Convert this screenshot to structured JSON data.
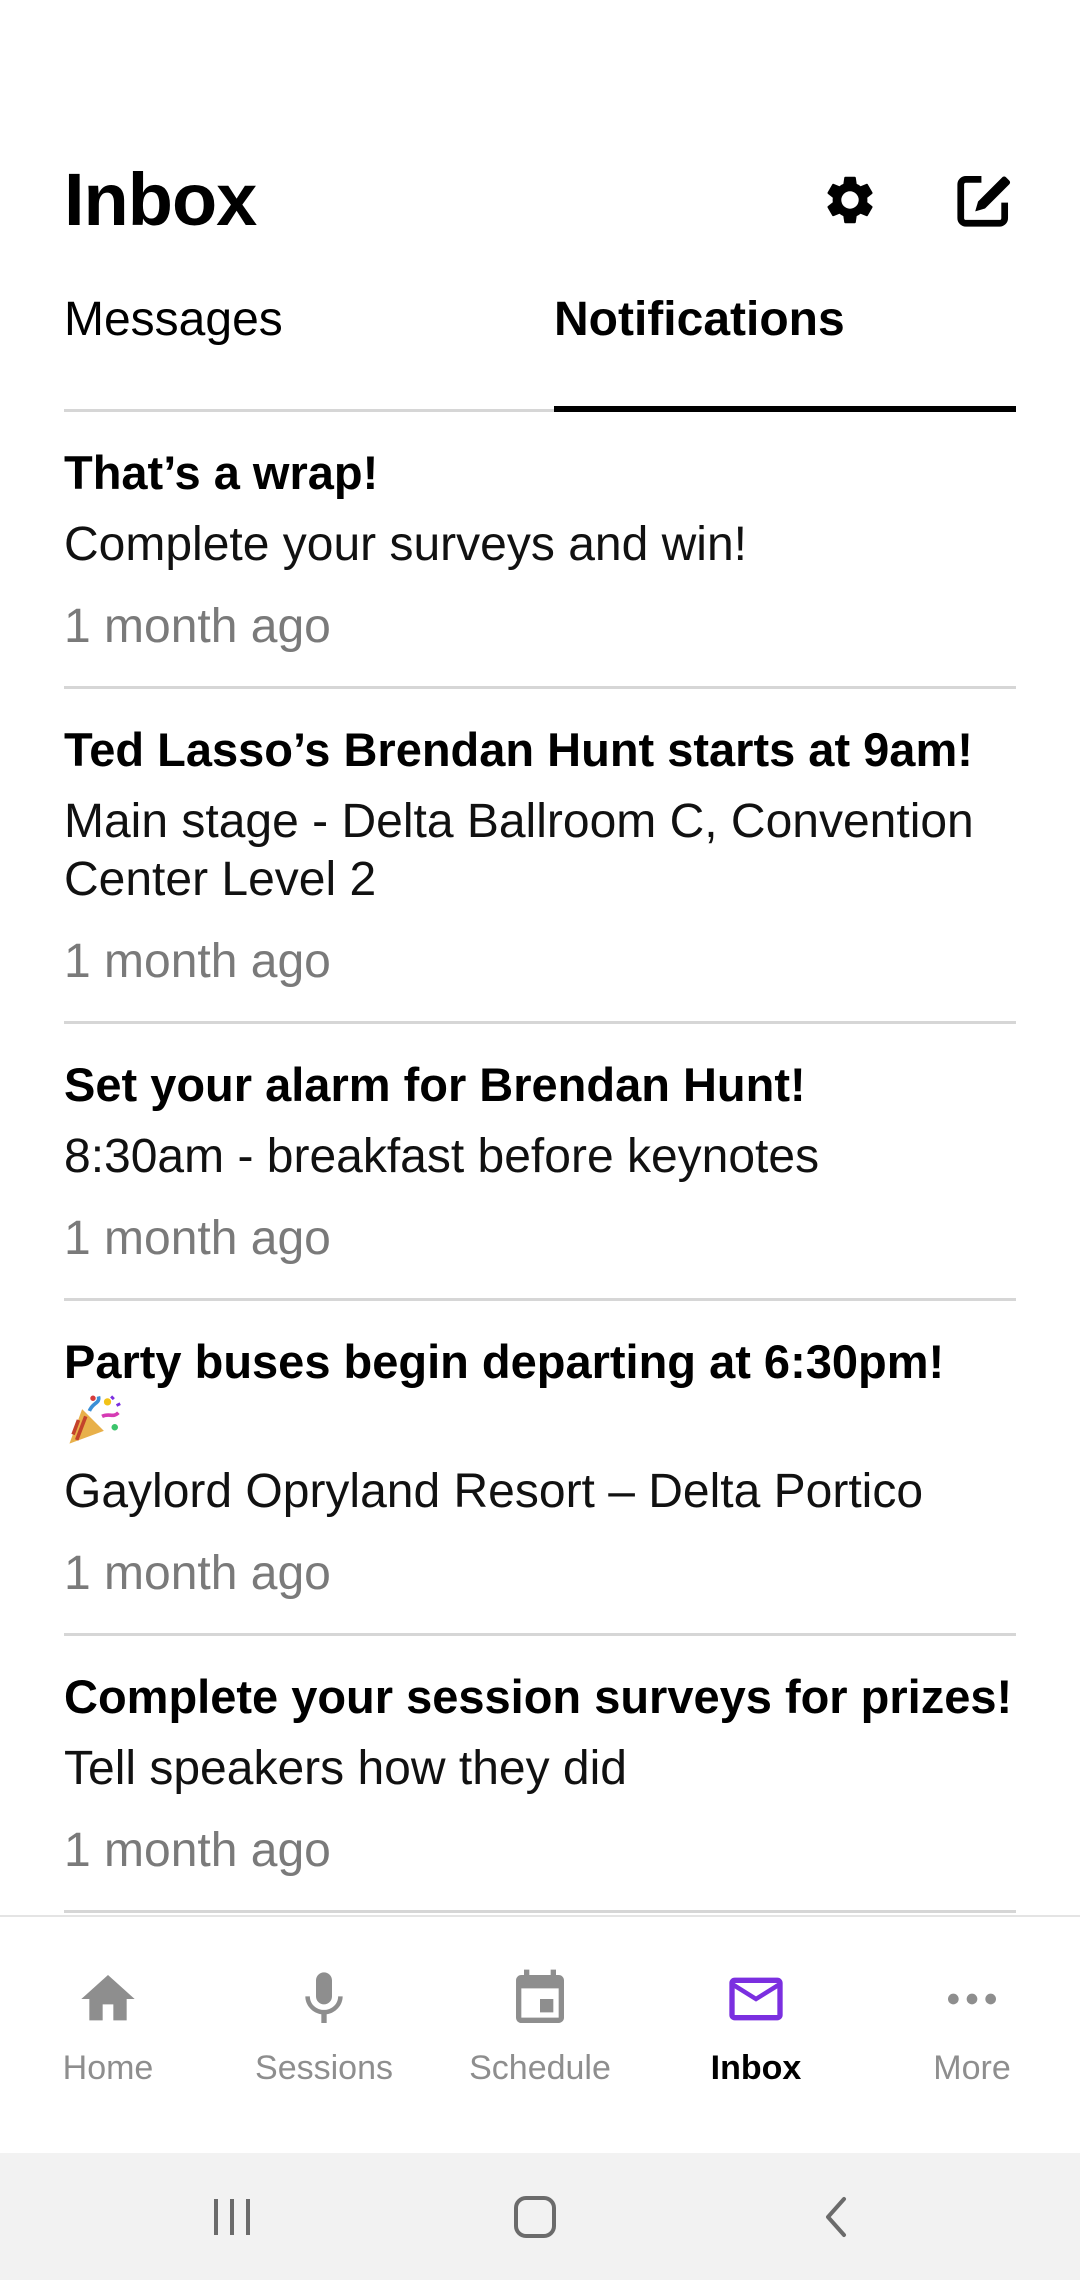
{
  "header": {
    "title": "Inbox",
    "settings_icon": "gear-icon",
    "compose_icon": "compose-icon"
  },
  "tabs": [
    {
      "label": "Messages",
      "active": false
    },
    {
      "label": "Notifications",
      "active": true
    }
  ],
  "notifications": [
    {
      "title": "That’s a wrap!",
      "body": "Complete your surveys and win!",
      "time": "1 month ago"
    },
    {
      "title": "Ted Lasso’s Brendan Hunt starts at 9am!",
      "body": "Main stage - Delta Ballroom C, Convention Center Level 2",
      "time": "1 month ago"
    },
    {
      "title": "Set your alarm for Brendan Hunt!",
      "body": "8:30am - breakfast before keynotes",
      "time": "1 month ago"
    },
    {
      "title": "Party buses begin departing at 6:30pm!",
      "title_icon": "party-popper-icon",
      "body": "Gaylord Opryland Resort – Delta Portico",
      "time": "1 month ago"
    },
    {
      "title": "Complete your session surveys for prizes!",
      "body": "Tell speakers how they did",
      "time": "1 month ago"
    }
  ],
  "bottom_nav": [
    {
      "label": "Home",
      "icon": "home-icon",
      "active": false
    },
    {
      "label": "Sessions",
      "icon": "microphone-icon",
      "active": false
    },
    {
      "label": "Schedule",
      "icon": "calendar-icon",
      "active": false
    },
    {
      "label": "Inbox",
      "icon": "mail-icon",
      "active": true
    },
    {
      "label": "More",
      "icon": "more-icon",
      "active": false
    }
  ],
  "colors": {
    "accent": "#7b2fe0",
    "inactive": "#8e8e8e",
    "timestamp": "#7a7a7a",
    "divider": "#d6d6d6"
  }
}
